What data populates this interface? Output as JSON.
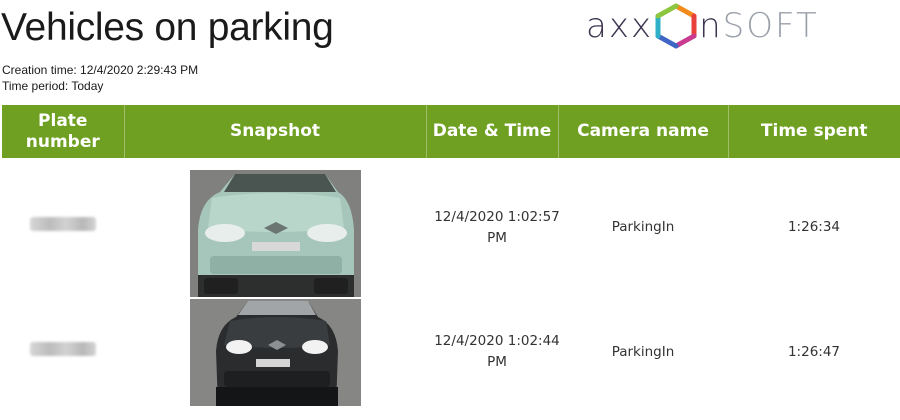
{
  "report": {
    "title": "Vehicles on parking",
    "creation_label": "Creation time:",
    "creation_value": "12/4/2020 2:29:43 PM",
    "period_label": "Time period:",
    "period_value": "Today"
  },
  "logo": {
    "part1": "axx",
    "part2": "n",
    "part3": "SOFT"
  },
  "table": {
    "headers": [
      "Plate number",
      "Snapshot",
      "Date & Time",
      "Camera name",
      "Time spent"
    ],
    "rows": [
      {
        "plate_icon": "blurred-plate",
        "snapshot_icon": "silver-green-hatchback-car",
        "datetime": "12/4/2020 1:02:57 PM",
        "camera": "ParkingIn",
        "time_spent": "1:26:34"
      },
      {
        "plate_icon": "blurred-plate",
        "snapshot_icon": "black-hatchback-car",
        "datetime": "12/4/2020 1:02:44 PM",
        "camera": "ParkingIn",
        "time_spent": "1:26:47"
      }
    ]
  },
  "colors": {
    "header_bg": "#6fa022",
    "header_text": "#ffffff",
    "logo_dark": "#3d3550",
    "logo_gray": "#9aa0aa"
  }
}
